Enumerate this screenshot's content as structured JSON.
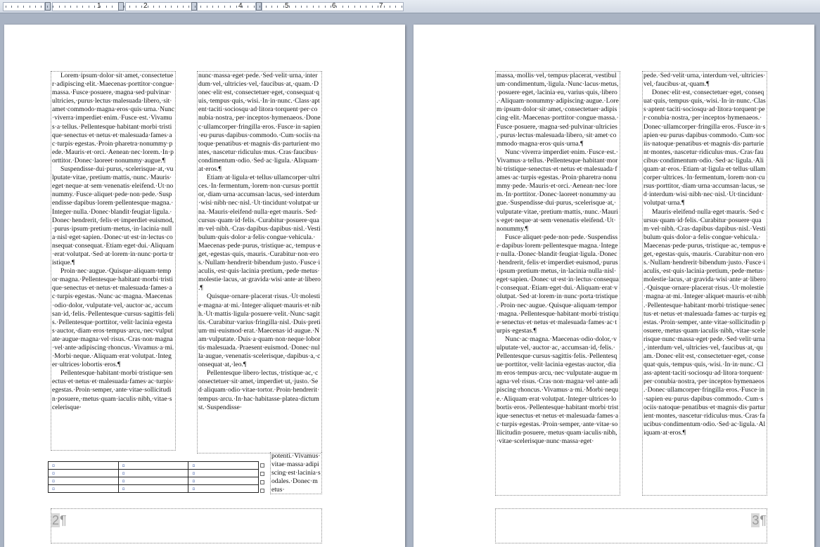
{
  "ruler": {
    "numbers": [
      "1",
      "2",
      "4",
      "5",
      "6",
      "7"
    ]
  },
  "pages": [
    {
      "page_number": "2",
      "columns": [
        [
          {
            "indent": true,
            "text": "Lorem·ipsum·dolor·sit·amet,·consectetuer·adipiscing·elit.·Maecenas·porttitor·congue·massa.·Fusce·posuere,·magna·sed·pulvinar·ultricies,·purus·lectus·malesuada·libero,·sit·amet·commodo·magna·eros·quis·urna.·Nunc·viverra·imperdiet·enim.·Fusce·est.·Vivamus·a·tellus.·Pellentesque·habitant·morbi·tristique·senectus·et·netus·et·malesuada·fames·ac·turpis·egestas.·Proin·pharetra·nonummy·pede.·Mauris·et·orci.·Aenean·nec·lorem.·In·porttitor.·Donec·laoreet·nonummy·augue.¶"
          },
          {
            "indent": true,
            "text": "Suspendisse·dui·purus,·scelerisque·at,·vulputate·vitae,·pretium·mattis,·nunc.·Mauris·eget·neque·at·sem·venenatis·eleifend.·Ut·nonummy.·Fusce·aliquet·pede·non·pede.·Suspendisse·dapibus·lorem·pellentesque·magna.·Integer·nulla.·Donec·blandit·feugiat·ligula.·Donec·hendrerit,·felis·et·imperdiet·euismod,·purus·ipsum·pretium·metus,·in·lacinia·nulla·nisl·eget·sapien.·Donec·ut·est·in·lectus·consequat·consequat.·Etiam·eget·dui.·Aliquam·erat·volutpat.·Sed·at·lorem·in·nunc·porta·tristique.¶"
          },
          {
            "indent": true,
            "text": "Proin·nec·augue.·Quisque·aliquam·tempor·magna.·Pellentesque·habitant·morbi·tristique·senectus·et·netus·et·malesuada·fames·ac·turpis·egestas.·Nunc·ac·magna.·Maecenas·odio·dolor,·vulputate·vel,·auctor·ac,·accumsan·id,·felis.·Pellentesque·cursus·sagittis·felis.·Pellentesque·porttitor,·velit·lacinia·egestas·auctor,·diam·eros·tempus·arcu,·nec·vulputate·augue·magna·vel·risus.·Cras·non·magna·vel·ante·adipiscing·rhoncus.·Vivamus·a·mi.·Morbi·neque.·Aliquam·erat·volutpat.·Integer·ultrices·lobortis·eros.¶"
          },
          {
            "indent": true,
            "text": "Pellentesque·habitant·morbi·tristique·senectus·et·netus·et·malesuada·fames·ac·turpis·egestas.·Proin·semper,·ante·vitae·sollicitudin·posuere,·metus·quam·iaculis·nibh,·vitae·scelerisque·"
          }
        ],
        [
          {
            "indent": false,
            "text": "nunc·massa·eget·pede.·Sed·velit·urna,·interdum·vel,·ultricies·vel,·faucibus·at,·quam.·Donec·elit·est,·consectetuer·eget,·consequat·quis,·tempus·quis,·wisi.·In·in·nunc.·Class·aptent·taciti·sociosqu·ad·litora·torquent·per·conubia·nostra,·per·inceptos·hymenaeos.·Donec·ullamcorper·fringilla·eros.·Fusce·in·sapien·eu·purus·dapibus·commodo.·Cum·sociis·natoque·penatibus·et·magnis·dis·parturient·montes,·nascetur·ridiculus·mus.·Cras·faucibus·condimentum·odio.·Sed·ac·ligula.·Aliquam·at·eros.¶"
          },
          {
            "indent": true,
            "text": "Etiam·at·ligula·et·tellus·ullamcorper·ultrices.·In·fermentum,·lorem·non·cursus·porttitor,·diam·urna·accumsan·lacus,·sed·interdum·wisi·nibh·nec·nisl.·Ut·tincidunt·volutpat·urna.·Mauris·eleifend·nulla·eget·mauris.·Sed·cursus·quam·id·felis.·Curabitur·posuere·quam·vel·nibh.·Cras·dapibus·dapibus·nisl.·Vestibulum·quis·dolor·a·felis·congue·vehicula.·Maecenas·pede·purus,·tristique·ac,·tempus·eget,·egestas·quis,·mauris.·Curabitur·non·eros.·Nullam·hendrerit·bibendum·justo.·Fusce·iaculis,·est·quis·lacinia·pretium,·pede·metus·molestie·lacus,·at·gravida·wisi·ante·at·libero.¶"
          },
          {
            "indent": true,
            "text": "Quisque·ornare·placerat·risus.·Ut·molestie·magna·at·mi.·Integer·aliquet·mauris·et·nibh.·Ut·mattis·ligula·posuere·velit.·Nunc·sagittis.·Curabitur·varius·fringilla·nisl.·Duis·pretium·mi·euismod·erat.·Maecenas·id·augue.·Nam·vulputate.·Duis·a·quam·non·neque·lobortis·malesuada.·Praesent·euismod.·Donec·nulla·augue,·venenatis·scelerisque,·dapibus·a,·consequat·at,·leo.¶"
          },
          {
            "indent": true,
            "text": "Pellentesque·libero·lectus,·tristique·ac,·consectetuer·sit·amet,·imperdiet·ut,·justo.·Sed·aliquam·odio·vitae·tortor.·Proin·hendrerit·tempus·arcu.·In·hac·habitasse·platea·dictumst.·Suspendisse·"
          }
        ]
      ],
      "continuation": "potenti.·Vivamus·vitae·massa·adipiscing·est·lacinia·sodales.·Donec·metus·",
      "table": {
        "rows": 4,
        "cols": 3,
        "cell_mark": "¤"
      }
    },
    {
      "page_number": "3",
      "columns": [
        [
          {
            "indent": false,
            "text": "massa,·mollis·vel,·tempus·placerat,·vestibulum·condimentum,·ligula.·Nunc·lacus·metus,·posuere·eget,·lacinia·eu,·varius·quis,·libero.·Aliquam·nonummy·adipiscing·augue.·Lorem·ipsum·dolor·sit·amet,·consectetuer·adipiscing·elit.·Maecenas·porttitor·congue·massa.·Fusce·posuere,·magna·sed·pulvinar·ultricies,·purus·lectus·malesuada·libero,·sit·amet·commodo·magna·eros·quis·urna.¶"
          },
          {
            "indent": true,
            "text": "Nunc·viverra·imperdiet·enim.·Fusce·est.·Vivamus·a·tellus.·Pellentesque·habitant·morbi·tristique·senectus·et·netus·et·malesuada·fames·ac·turpis·egestas.·Proin·pharetra·nonummy·pede.·Mauris·et·orci.·Aenean·nec·lorem.·In·porttitor.·Donec·laoreet·nonummy·augue.·Suspendisse·dui·purus,·scelerisque·at,·vulputate·vitae,·pretium·mattis,·nunc.·Mauris·eget·neque·at·sem·venenatis·eleifend.·Ut·nonummy.¶"
          },
          {
            "indent": true,
            "text": "Fusce·aliquet·pede·non·pede.·Suspendisse·dapibus·lorem·pellentesque·magna.·Integer·nulla.·Donec·blandit·feugiat·ligula.·Donec·hendrerit,·felis·et·imperdiet·euismod,·purus·ipsum·pretium·metus,·in·lacinia·nulla·nisl·eget·sapien.·Donec·ut·est·in·lectus·consequat·consequat.·Etiam·eget·dui.·Aliquam·erat·volutpat.·Sed·at·lorem·in·nunc·porta·tristique.·Proin·nec·augue.·Quisque·aliquam·tempor·magna.·Pellentesque·habitant·morbi·tristique·senectus·et·netus·et·malesuada·fames·ac·turpis·egestas.¶"
          },
          {
            "indent": true,
            "text": "Nunc·ac·magna.·Maecenas·odio·dolor,·vulputate·vel,·auctor·ac,·accumsan·id,·felis.·Pellentesque·cursus·sagittis·felis.·Pellentesque·porttitor,·velit·lacinia·egestas·auctor,·diam·eros·tempus·arcu,·nec·vulputate·augue·magna·vel·risus.·Cras·non·magna·vel·ante·adipiscing·rhoncus.·Vivamus·a·mi.·Morbi·neque.·Aliquam·erat·volutpat.·Integer·ultrices·lobortis·eros.·Pellentesque·habitant·morbi·tristique·senectus·et·netus·et·malesuada·fames·ac·turpis·egestas.·Proin·semper,·ante·vitae·sollicitudin·posuere,·metus·quam·iaculis·nibh,·vitae·scelerisque·nunc·massa·eget·"
          }
        ],
        [
          {
            "indent": false,
            "text": "pede.·Sed·velit·urna,·interdum·vel,·ultricies·vel,·faucibus·at,·quam.¶"
          },
          {
            "indent": true,
            "text": "Donec·elit·est,·consectetuer·eget,·consequat·quis,·tempus·quis,·wisi.·In·in·nunc.·Class·aptent·taciti·sociosqu·ad·litora·torquent·per·conubia·nostra,·per·inceptos·hymenaeos.·Donec·ullamcorper·fringilla·eros.·Fusce·in·sapien·eu·purus·dapibus·commodo.·Cum·sociis·natoque·penatibus·et·magnis·dis·parturient·montes,·nascetur·ridiculus·mus.·Cras·faucibus·condimentum·odio.·Sed·ac·ligula.·Aliquam·at·eros.·Etiam·at·ligula·et·tellus·ullamcorper·ultrices.·In·fermentum,·lorem·non·cursus·porttitor,·diam·urna·accumsan·lacus,·sed·interdum·wisi·nibh·nec·nisl.·Ut·tincidunt·volutpat·urna.¶"
          },
          {
            "indent": true,
            "text": "Mauris·eleifend·nulla·eget·mauris.·Sed·cursus·quam·id·felis.·Curabitur·posuere·quam·vel·nibh.·Cras·dapibus·dapibus·nisl.·Vestibulum·quis·dolor·a·felis·congue·vehicula.·Maecenas·pede·purus,·tristique·ac,·tempus·eget,·egestas·quis,·mauris.·Curabitur·non·eros.·Nullam·hendrerit·bibendum·justo.·Fusce·iaculis,·est·quis·lacinia·pretium,·pede·metus·molestie·lacus,·at·gravida·wisi·ante·at·libero.·Quisque·ornare·placerat·risus.·Ut·molestie·magna·at·mi.·Integer·aliquet·mauris·et·nibh.·Pellentesque·habitant·morbi·tristique·senectus·et·netus·et·malesuada·fames·ac·turpis·egestas.·Proin·semper,·ante·vitae·sollicitudin·posuere,·metus·quam·iaculis·nibh,·vitae·scelerisque·nunc·massa·eget·pede.·Sed·velit·urna,·interdum·vel,·ultricies·vel,·faucibus·at,·quam.·Donec·elit·est,·consectetuer·eget,·consequat·quis,·tempus·quis,·wisi.·In·in·nunc.·Class·aptent·taciti·sociosqu·ad·litora·torquent·per·conubia·nostra,·per·inceptos·hymenaeos.·Donec·ullamcorper·fringilla·eros.·Fusce·in·sapien·eu·purus·dapibus·commodo.·Cum·sociis·natoque·penatibus·et·magnis·dis·parturient·montes,·nascetur·ridiculus·mus.·Cras·faucibus·condimentum·odio.·Sed·ac·ligula.·Aliquam·at·eros.¶"
          }
        ]
      ]
    }
  ]
}
